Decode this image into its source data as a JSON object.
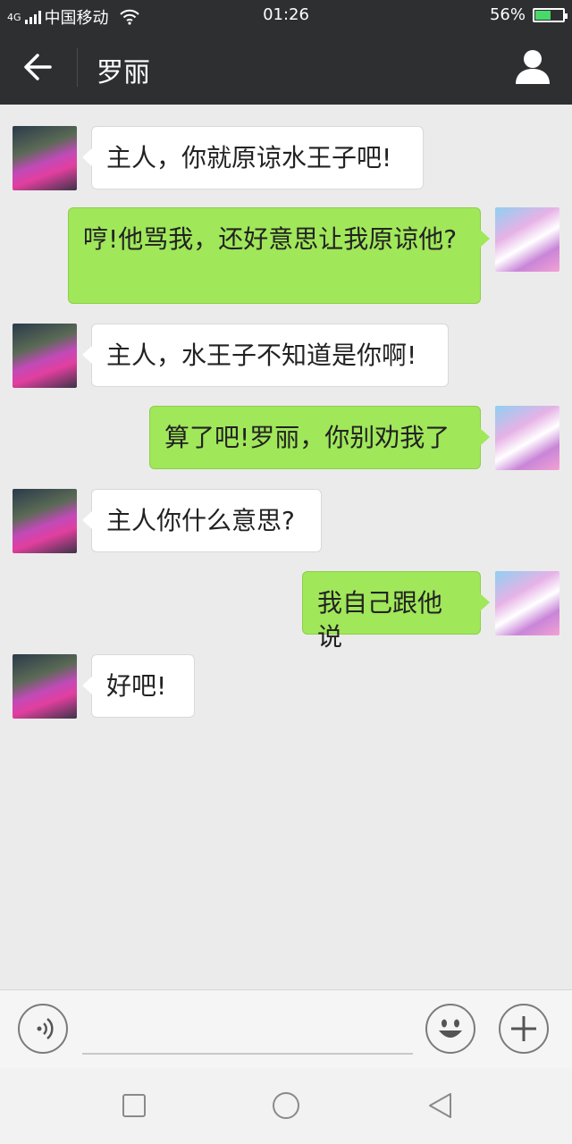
{
  "status_bar": {
    "network": "4G",
    "carrier": "中国移动",
    "time": "01:26",
    "battery_percent": "56%",
    "battery_level": 0.56,
    "icons": [
      "signal-icon",
      "wifi-icon",
      "battery-icon"
    ]
  },
  "header": {
    "title": "罗丽",
    "back_icon": "arrow-left-icon",
    "profile_icon": "person-icon"
  },
  "messages": [
    {
      "side": "left",
      "text": "主人，你就原谅水王子吧!"
    },
    {
      "side": "right",
      "text": "哼!他骂我，还好意思让我原谅他?"
    },
    {
      "side": "left",
      "text": "主人，水王子不知道是你啊!"
    },
    {
      "side": "right",
      "text": "算了吧!罗丽，你别劝我了"
    },
    {
      "side": "left",
      "text": "主人你什么意思?"
    },
    {
      "side": "right",
      "text": "我自己跟他说"
    },
    {
      "side": "left",
      "text": "好吧!"
    }
  ],
  "input_bar": {
    "voice_icon": "voice-icon",
    "placeholder": "",
    "value": "",
    "emoji_icon": "emoji-icon",
    "plus_icon": "plus-icon"
  },
  "nav_bar": {
    "icons": [
      "square-icon",
      "circle-icon",
      "triangle-back-icon"
    ]
  },
  "colors": {
    "header_bg": "#2e2f31",
    "chat_bg": "#ebebeb",
    "bubble_self": "#a0e75a",
    "bubble_other": "#ffffff",
    "battery_fill": "#49d86a"
  }
}
